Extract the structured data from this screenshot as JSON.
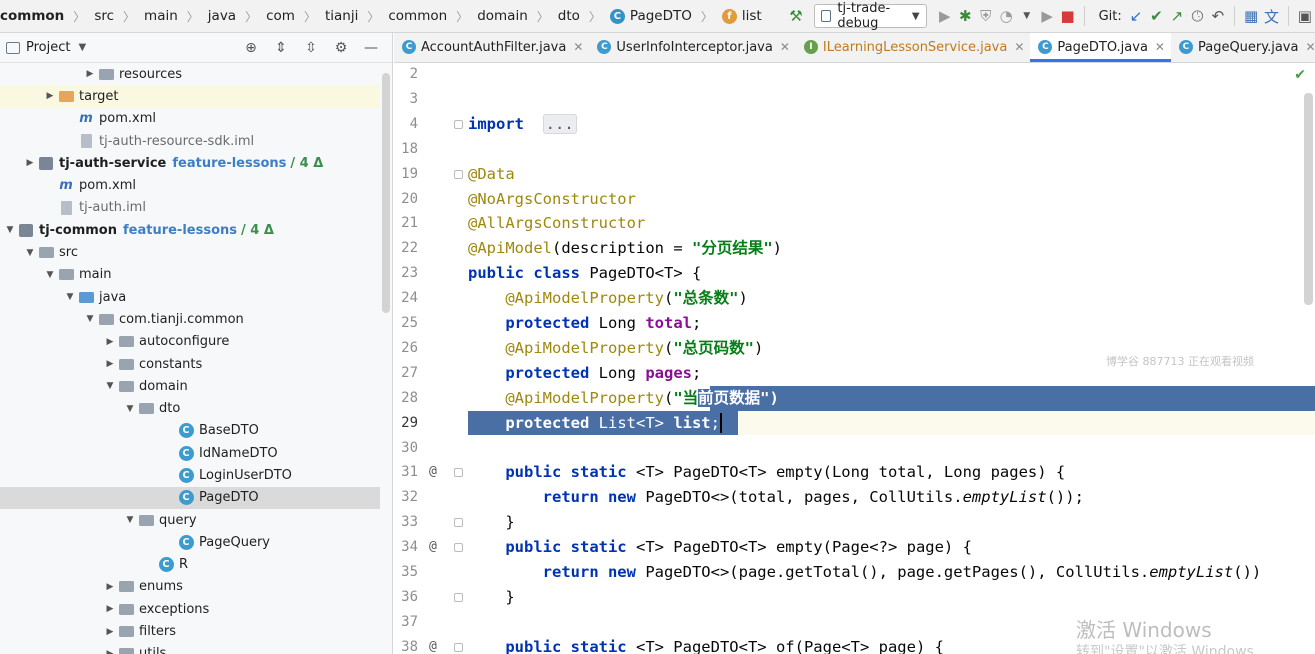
{
  "topbar": {
    "crumbs": [
      "common",
      "src",
      "main",
      "java",
      "com",
      "tianji",
      "common",
      "domain",
      "dto",
      "PageDTO",
      "list"
    ],
    "run_config": "tj-trade-debug",
    "git_label": "Git:"
  },
  "project_panel": {
    "title": "Project",
    "rows": [
      {
        "indent": 5,
        "arrow": "›",
        "icon": "folder-grey",
        "label": "resources"
      },
      {
        "indent": 3,
        "arrow": "›",
        "icon": "folder-orange",
        "label": "target",
        "highlight": "yellow"
      },
      {
        "indent": 4,
        "arrow": "",
        "icon": "maven",
        "label": "pom.xml"
      },
      {
        "indent": 4,
        "arrow": "",
        "icon": "iml",
        "label": "tj-auth-resource-sdk.iml",
        "muted": true
      },
      {
        "indent": 2,
        "arrow": "›",
        "icon": "module",
        "label": "tj-auth-service",
        "bold": true,
        "branch": "feature-lessons",
        "delta": "/ 4 Δ"
      },
      {
        "indent": 3,
        "arrow": "",
        "icon": "maven",
        "label": "pom.xml"
      },
      {
        "indent": 3,
        "arrow": "",
        "icon": "iml",
        "label": "tj-auth.iml",
        "muted": true
      },
      {
        "indent": 1,
        "arrow": "⌄",
        "icon": "module",
        "label": "tj-common",
        "bold": true,
        "branch": "feature-lessons",
        "delta": "/ 4 Δ"
      },
      {
        "indent": 2,
        "arrow": "⌄",
        "icon": "folder-grey",
        "label": "src"
      },
      {
        "indent": 3,
        "arrow": "⌄",
        "icon": "folder-grey",
        "label": "main"
      },
      {
        "indent": 4,
        "arrow": "⌄",
        "icon": "folder-blue",
        "label": "java"
      },
      {
        "indent": 5,
        "arrow": "⌄",
        "icon": "package",
        "label": "com.tianji.common"
      },
      {
        "indent": 6,
        "arrow": "›",
        "icon": "package",
        "label": "autoconfigure"
      },
      {
        "indent": 6,
        "arrow": "›",
        "icon": "package",
        "label": "constants"
      },
      {
        "indent": 6,
        "arrow": "⌄",
        "icon": "package",
        "label": "domain"
      },
      {
        "indent": 7,
        "arrow": "⌄",
        "icon": "package",
        "label": "dto"
      },
      {
        "indent": 9,
        "arrow": "",
        "icon": "class",
        "label": "BaseDTO"
      },
      {
        "indent": 9,
        "arrow": "",
        "icon": "class",
        "label": "IdNameDTO"
      },
      {
        "indent": 9,
        "arrow": "",
        "icon": "class",
        "label": "LoginUserDTO"
      },
      {
        "indent": 9,
        "arrow": "",
        "icon": "class",
        "label": "PageDTO",
        "selected": true
      },
      {
        "indent": 7,
        "arrow": "⌄",
        "icon": "package",
        "label": "query"
      },
      {
        "indent": 9,
        "arrow": "",
        "icon": "class",
        "label": "PageQuery"
      },
      {
        "indent": 8,
        "arrow": "",
        "icon": "class",
        "label": "R"
      },
      {
        "indent": 6,
        "arrow": "›",
        "icon": "package",
        "label": "enums"
      },
      {
        "indent": 6,
        "arrow": "›",
        "icon": "package",
        "label": "exceptions"
      },
      {
        "indent": 6,
        "arrow": "›",
        "icon": "package",
        "label": "filters"
      },
      {
        "indent": 6,
        "arrow": "›",
        "icon": "package",
        "label": "utils"
      }
    ]
  },
  "tabs": [
    {
      "label": "AccountAuthFilter.java",
      "icon": "C"
    },
    {
      "label": "UserInfoInterceptor.java",
      "icon": "C"
    },
    {
      "label": "ILearningLessonService.java",
      "icon": "I",
      "green": true
    },
    {
      "label": "PageDTO.java",
      "icon": "C",
      "active": true
    },
    {
      "label": "PageQuery.java",
      "icon": "C"
    }
  ],
  "editor": {
    "lines": [
      {
        "num": "2",
        "segs": []
      },
      {
        "num": "3",
        "segs": []
      },
      {
        "num": "4",
        "fold": true,
        "segs": [
          [
            "kw",
            "import"
          ],
          [
            "",
            "  "
          ],
          [
            "folded",
            "..."
          ]
        ]
      },
      {
        "num": "18",
        "segs": []
      },
      {
        "num": "19",
        "fold": true,
        "segs": [
          [
            "ann",
            "@Data"
          ]
        ]
      },
      {
        "num": "20",
        "segs": [
          [
            "ann",
            "@NoArgsConstructor"
          ]
        ]
      },
      {
        "num": "21",
        "segs": [
          [
            "ann",
            "@AllArgsConstructor"
          ]
        ]
      },
      {
        "num": "22",
        "segs": [
          [
            "ann",
            "@ApiModel"
          ],
          [
            "",
            "(description = "
          ],
          [
            "str",
            "\"分页结果\""
          ],
          [
            "",
            ")"
          ]
        ]
      },
      {
        "num": "23",
        "segs": [
          [
            "kw",
            "public class "
          ],
          [
            "",
            "PageDTO<T> {"
          ]
        ]
      },
      {
        "num": "24",
        "segs": [
          [
            "",
            "    "
          ],
          [
            "ann",
            "@ApiModelProperty"
          ],
          [
            "",
            "("
          ],
          [
            "str",
            "\"总条数\""
          ],
          [
            "",
            ")"
          ]
        ]
      },
      {
        "num": "25",
        "segs": [
          [
            "",
            "    "
          ],
          [
            "kw",
            "protected "
          ],
          [
            "",
            "Long "
          ],
          [
            "fld",
            "total"
          ],
          [
            "",
            ";"
          ]
        ]
      },
      {
        "num": "26",
        "segs": [
          [
            "",
            "    "
          ],
          [
            "ann",
            "@ApiModelProperty"
          ],
          [
            "",
            "("
          ],
          [
            "str",
            "\"总页码数\""
          ],
          [
            "",
            ")"
          ]
        ]
      },
      {
        "num": "27",
        "segs": [
          [
            "",
            "    "
          ],
          [
            "kw",
            "protected "
          ],
          [
            "",
            "Long "
          ],
          [
            "fld",
            "pages"
          ],
          [
            "",
            ";"
          ]
        ]
      },
      {
        "num": "28",
        "segs": [
          [
            "",
            "    "
          ],
          [
            "ann",
            "@ApiModelProperty"
          ],
          [
            "",
            "("
          ],
          [
            "str",
            "\"当"
          ],
          [
            "selstr",
            "前页数据\")"
          ]
        ]
      },
      {
        "num": "29",
        "current": true,
        "segs": [
          [
            "",
            "    "
          ],
          [
            "selkw",
            "protected "
          ],
          [
            "sel",
            "List<T> "
          ],
          [
            "selfld",
            "list"
          ],
          [
            "sel",
            ";"
          ],
          [
            "caret",
            ""
          ]
        ]
      },
      {
        "num": "30",
        "segs": []
      },
      {
        "num": "31",
        "mark": "@",
        "fold": true,
        "segs": [
          [
            "",
            "    "
          ],
          [
            "kw",
            "public static "
          ],
          [
            "",
            "<T> PageDTO<T> empty(Long total, Long pages) {"
          ]
        ]
      },
      {
        "num": "32",
        "segs": [
          [
            "",
            "        "
          ],
          [
            "kw",
            "return new "
          ],
          [
            "",
            "PageDTO<>(total, pages, CollUtils."
          ],
          [
            "ital",
            "emptyList"
          ],
          [
            "",
            "());"
          ]
        ]
      },
      {
        "num": "33",
        "fold": true,
        "segs": [
          [
            "",
            "    }"
          ]
        ]
      },
      {
        "num": "34",
        "mark": "@",
        "fold": true,
        "segs": [
          [
            "",
            "    "
          ],
          [
            "kw",
            "public static "
          ],
          [
            "",
            "<T> PageDTO<T> empty(Page<?> page) {"
          ]
        ]
      },
      {
        "num": "35",
        "segs": [
          [
            "",
            "        "
          ],
          [
            "kw",
            "return new "
          ],
          [
            "",
            "PageDTO<>(page.getTotal(), page.getPages(), CollUtils."
          ],
          [
            "ital",
            "emptyList"
          ],
          [
            "",
            "())"
          ]
        ]
      },
      {
        "num": "36",
        "fold": true,
        "segs": [
          [
            "",
            "    }"
          ]
        ]
      },
      {
        "num": "37",
        "segs": []
      },
      {
        "num": "38",
        "mark": "@",
        "fold": true,
        "segs": [
          [
            "",
            "    "
          ],
          [
            "kw",
            "public static "
          ],
          [
            "",
            "<T> PageDTO<T> of(Page<T> page) {"
          ]
        ]
      }
    ]
  },
  "overlays": {
    "watermark": "博学谷 887713 正在观看视频",
    "windows_activate": "激活 Windows",
    "windows_hint": "转到\"设置\"以激活 Windows"
  }
}
